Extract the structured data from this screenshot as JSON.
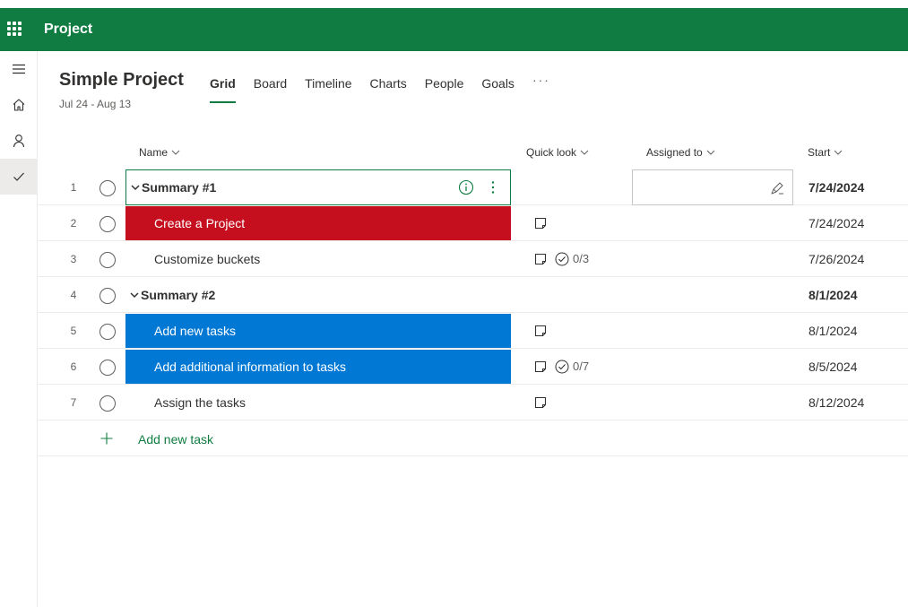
{
  "app": {
    "title": "Project"
  },
  "project": {
    "title": "Simple Project",
    "dates": "Jul 24 - Aug 13"
  },
  "tabs": [
    {
      "label": "Grid",
      "active": true
    },
    {
      "label": "Board",
      "active": false
    },
    {
      "label": "Timeline",
      "active": false
    },
    {
      "label": "Charts",
      "active": false
    },
    {
      "label": "People",
      "active": false
    },
    {
      "label": "Goals",
      "active": false
    }
  ],
  "more_label": "···",
  "columns": {
    "name": "Name",
    "quick": "Quick look",
    "assigned": "Assigned to",
    "start": "Start"
  },
  "rows": [
    {
      "num": "1",
      "name": "Summary #1",
      "start": "7/24/2024",
      "summary": true
    },
    {
      "num": "2",
      "name": "Create a Project",
      "start": "7/24/2024",
      "highlight": "red"
    },
    {
      "num": "3",
      "name": "Customize buckets",
      "start": "7/26/2024",
      "checklist": "0/3"
    },
    {
      "num": "4",
      "name": "Summary #2",
      "start": "8/1/2024",
      "summary": true
    },
    {
      "num": "5",
      "name": "Add new tasks",
      "start": "8/1/2024",
      "highlight": "blue"
    },
    {
      "num": "6",
      "name": "Add additional information to tasks",
      "start": "8/5/2024",
      "highlight": "blue",
      "checklist": "0/7"
    },
    {
      "num": "7",
      "name": "Assign the tasks",
      "start": "8/12/2024"
    }
  ],
  "add_task_label": "Add new task",
  "colors": {
    "brand": "#107c41",
    "red": "#c50f1f",
    "blue": "#0078d4"
  },
  "icons": [
    "waffle-icon",
    "hamburger-icon",
    "home-icon",
    "person-icon",
    "checkmark-icon",
    "chevron-down-icon",
    "info-icon",
    "more-vertical-icon",
    "note-icon",
    "checklist-icon",
    "assign-icon",
    "plus-icon"
  ]
}
